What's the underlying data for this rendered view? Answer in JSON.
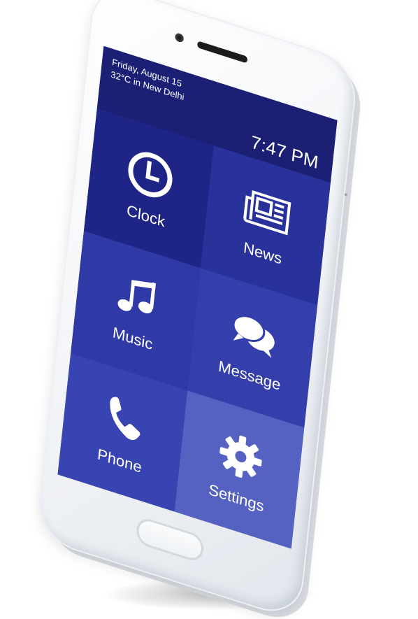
{
  "status_bar": {
    "date": "Friday, August 15",
    "weather": "32°C in New Delhi",
    "time": "7:47 PM"
  },
  "tiles": [
    {
      "label": "Clock",
      "icon": "clock-icon"
    },
    {
      "label": "News",
      "icon": "newspaper-icon"
    },
    {
      "label": "Music",
      "icon": "music-note-icon"
    },
    {
      "label": "Message",
      "icon": "chat-bubbles-icon"
    },
    {
      "label": "Phone",
      "icon": "phone-handset-icon"
    },
    {
      "label": "Settings",
      "icon": "gear-icon"
    }
  ],
  "colors": {
    "status_bar_bg": "#1b2074",
    "clock_tile": "#1f2586",
    "news_tile": "#29329a",
    "music_tile": "#2f3aa6",
    "message_tile": "#343fac",
    "phone_tile": "#3844b2",
    "settings_tile": "#5662c1",
    "text": "#ffffff"
  }
}
